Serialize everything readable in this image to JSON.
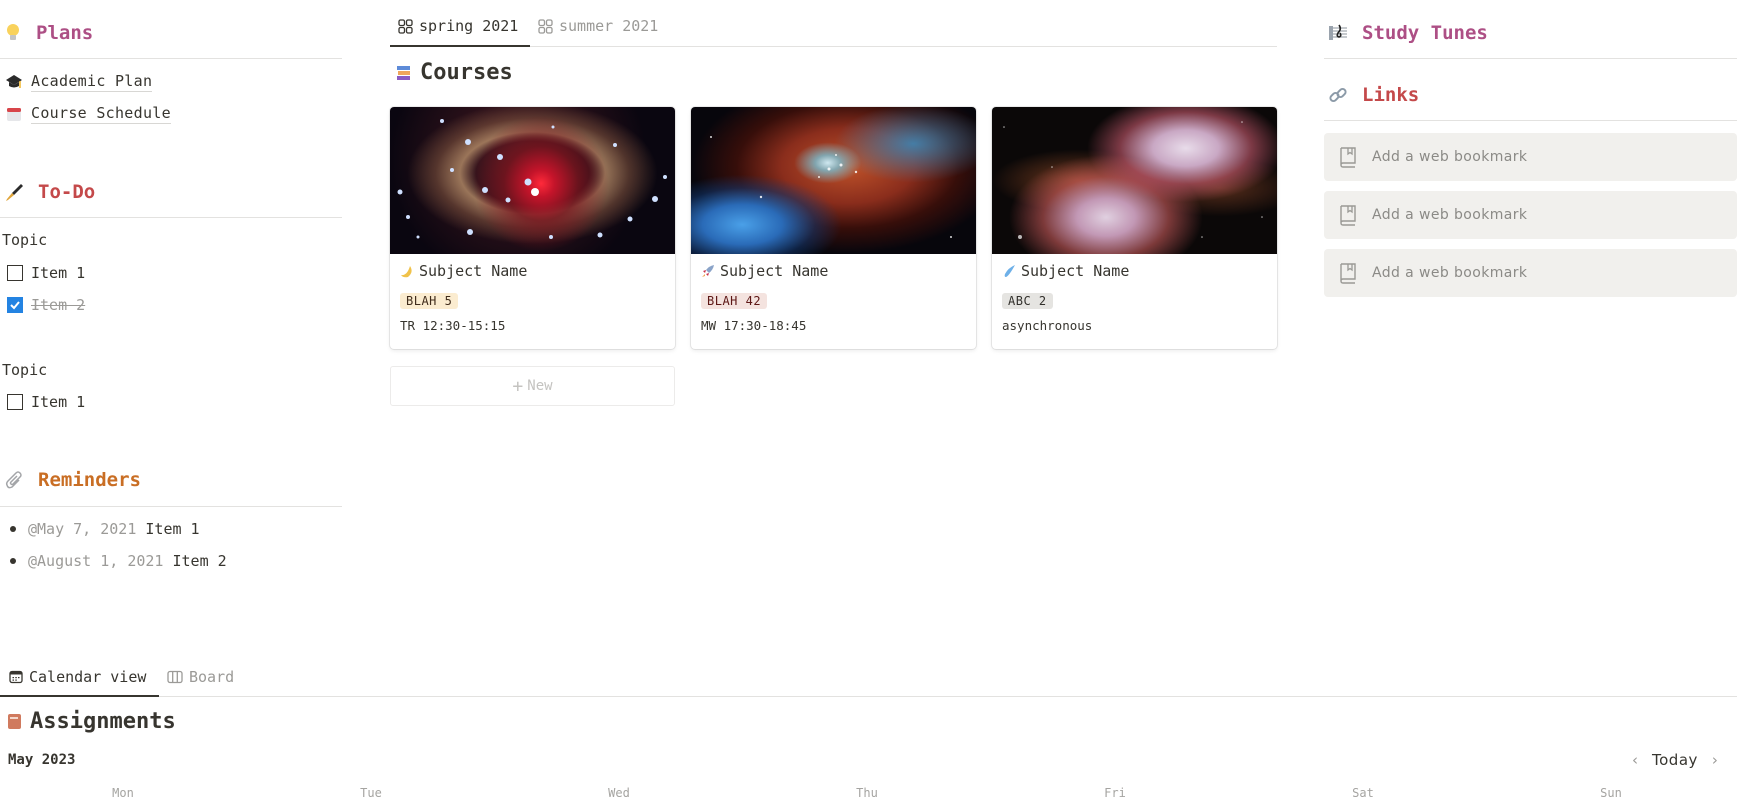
{
  "left": {
    "plans": {
      "icon": "lightbulb-icon",
      "title": "Plans",
      "color": "#ad4f85",
      "links": [
        {
          "icon": "graduation-cap-icon",
          "label": "Academic Plan"
        },
        {
          "icon": "calendar-icon",
          "label": "Course Schedule"
        }
      ]
    },
    "todo": {
      "icon": "fountain-pen-icon",
      "title": "To-Do",
      "color": "#c4494a",
      "groups": [
        {
          "topic": "Topic",
          "items": [
            {
              "label": "Item 1",
              "checked": false
            },
            {
              "label": "Item 2",
              "checked": true
            }
          ]
        },
        {
          "topic": "Topic",
          "items": [
            {
              "label": "Item 1",
              "checked": false
            }
          ]
        }
      ]
    },
    "reminders": {
      "icon": "paperclip-icon",
      "title": "Reminders",
      "color": "#c96e24",
      "items": [
        {
          "date": "@May 7, 2021",
          "label": "Item 1"
        },
        {
          "date": "@August 1, 2021",
          "label": "Item 2"
        }
      ]
    }
  },
  "courses": {
    "tabs": [
      {
        "icon": "gallery-icon",
        "label": "spring 2021",
        "active": true
      },
      {
        "icon": "gallery-icon",
        "label": "summer 2021",
        "active": false
      }
    ],
    "icon": "books-icon",
    "title": "Courses",
    "cards": [
      {
        "icon": "crescent-moon-icon",
        "name": "Subject Name",
        "code": "BLAH 5",
        "badge_bg": "#fbecd0",
        "badge_fg": "#402c1b",
        "schedule": "TR 12:30-15:15",
        "cover": "v838-monocerotis"
      },
      {
        "icon": "rocket-icon",
        "name": "Subject Name",
        "code": "BLAH 42",
        "badge_bg": "#f4e3df",
        "badge_fg": "#5d1715",
        "schedule": "MW 17:30-18:45",
        "cover": "cosmic-reef"
      },
      {
        "icon": "comet-icon",
        "name": "Subject Name",
        "code": "ABC 2",
        "badge_bg": "#e5e4e1",
        "badge_fg": "#32302c",
        "schedule": "asynchronous",
        "cover": "butterfly-nebula"
      }
    ],
    "new_label": "New"
  },
  "right": {
    "study_tunes": {
      "icon": "musical-score-icon",
      "title": "Study Tunes",
      "color": "#ad4f85"
    },
    "links": {
      "icon": "link-icon",
      "title": "Links",
      "color": "#c4494a",
      "bookmarks": [
        {
          "icon": "book-bookmark-icon",
          "label": "Add a web bookmark"
        },
        {
          "icon": "book-bookmark-icon",
          "label": "Add a web bookmark"
        },
        {
          "icon": "book-bookmark-icon",
          "label": "Add a web bookmark"
        }
      ]
    }
  },
  "assignments": {
    "tabs": [
      {
        "icon": "calendar-view-icon",
        "label": "Calendar view",
        "active": true
      },
      {
        "icon": "board-icon",
        "label": "Board",
        "active": false
      }
    ],
    "icon": "closed-book-icon",
    "title": "Assignments",
    "month": "May 2023",
    "today_label": "Today",
    "days": [
      "Mon",
      "Tue",
      "Wed",
      "Thu",
      "Fri",
      "Sat",
      "Sun"
    ]
  }
}
